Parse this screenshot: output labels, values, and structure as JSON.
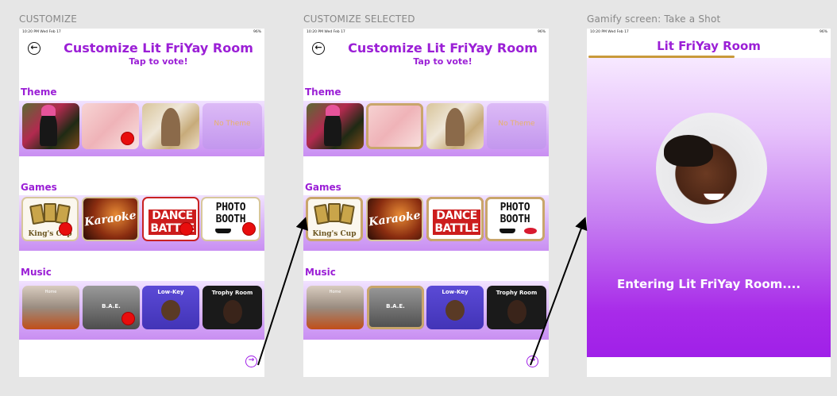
{
  "frames": [
    {
      "label": "CUSTOMIZE"
    },
    {
      "label": "CUSTOMIZE SELECTED"
    },
    {
      "label": "Gamify screen: Take a Shot"
    }
  ],
  "status": {
    "time": "10:20 PM  Wed Feb 17",
    "battery": "96%"
  },
  "customize": {
    "title": "Customize Lit FriYay Room",
    "subtitle": "Tap to vote!",
    "sections": {
      "theme": "Theme",
      "games": "Games",
      "music": "Music"
    },
    "theme_tiles": [
      "",
      "",
      "",
      "No Theme"
    ],
    "game_tiles": [
      "King's Cup",
      "Karaoke",
      "DANCE BATTLE",
      "PHOTO BOOTH"
    ],
    "music_tiles": [
      "Home",
      "B.A.E.",
      "Low-Key",
      "Trophy Room"
    ]
  },
  "gamify": {
    "title": "Lit FriYay Room",
    "progress": 0.6,
    "entering": "Entering Lit FriYay Room...."
  },
  "colors": {
    "accent": "#9b1fd6",
    "gold": "#c9a66b",
    "vote_dot": "#e80d0d"
  }
}
